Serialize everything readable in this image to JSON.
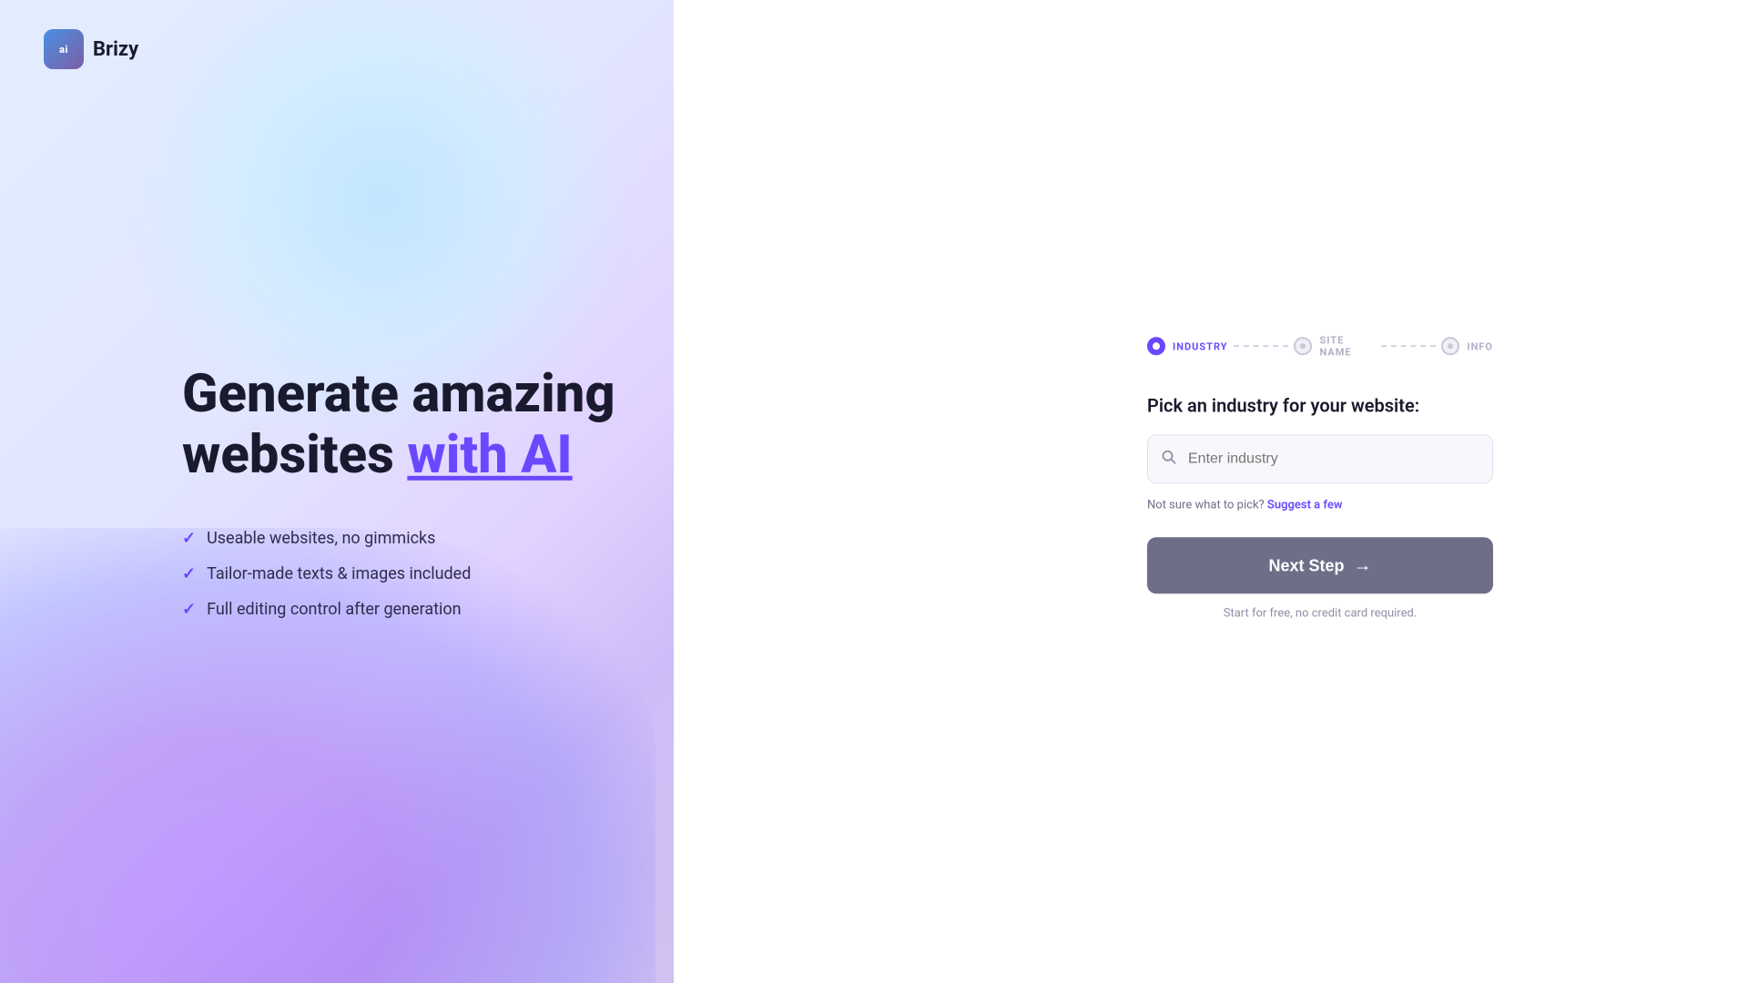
{
  "logo": {
    "icon_label": "ai",
    "name": "Brizy"
  },
  "hero": {
    "headline_part1": "Generate amazing",
    "headline_part2": "websites ",
    "headline_accent": "with AI",
    "features": [
      {
        "text": "Useable websites, no gimmicks"
      },
      {
        "text": "Tailor-made texts & images included"
      },
      {
        "text": "Full editing control after generation"
      }
    ]
  },
  "form": {
    "steps": [
      {
        "label": "INDUSTRY",
        "state": "active"
      },
      {
        "label": "SITE NAME",
        "state": "inactive"
      },
      {
        "label": "INFO",
        "state": "inactive"
      }
    ],
    "pick_label": "Pick an industry for your website:",
    "input_placeholder": "Enter industry",
    "suggest_prefix": "Not sure what to pick? ",
    "suggest_link": "Suggest a few",
    "next_step_label": "Next Step",
    "arrow": "→",
    "free_text": "Start for free, no credit card required."
  }
}
